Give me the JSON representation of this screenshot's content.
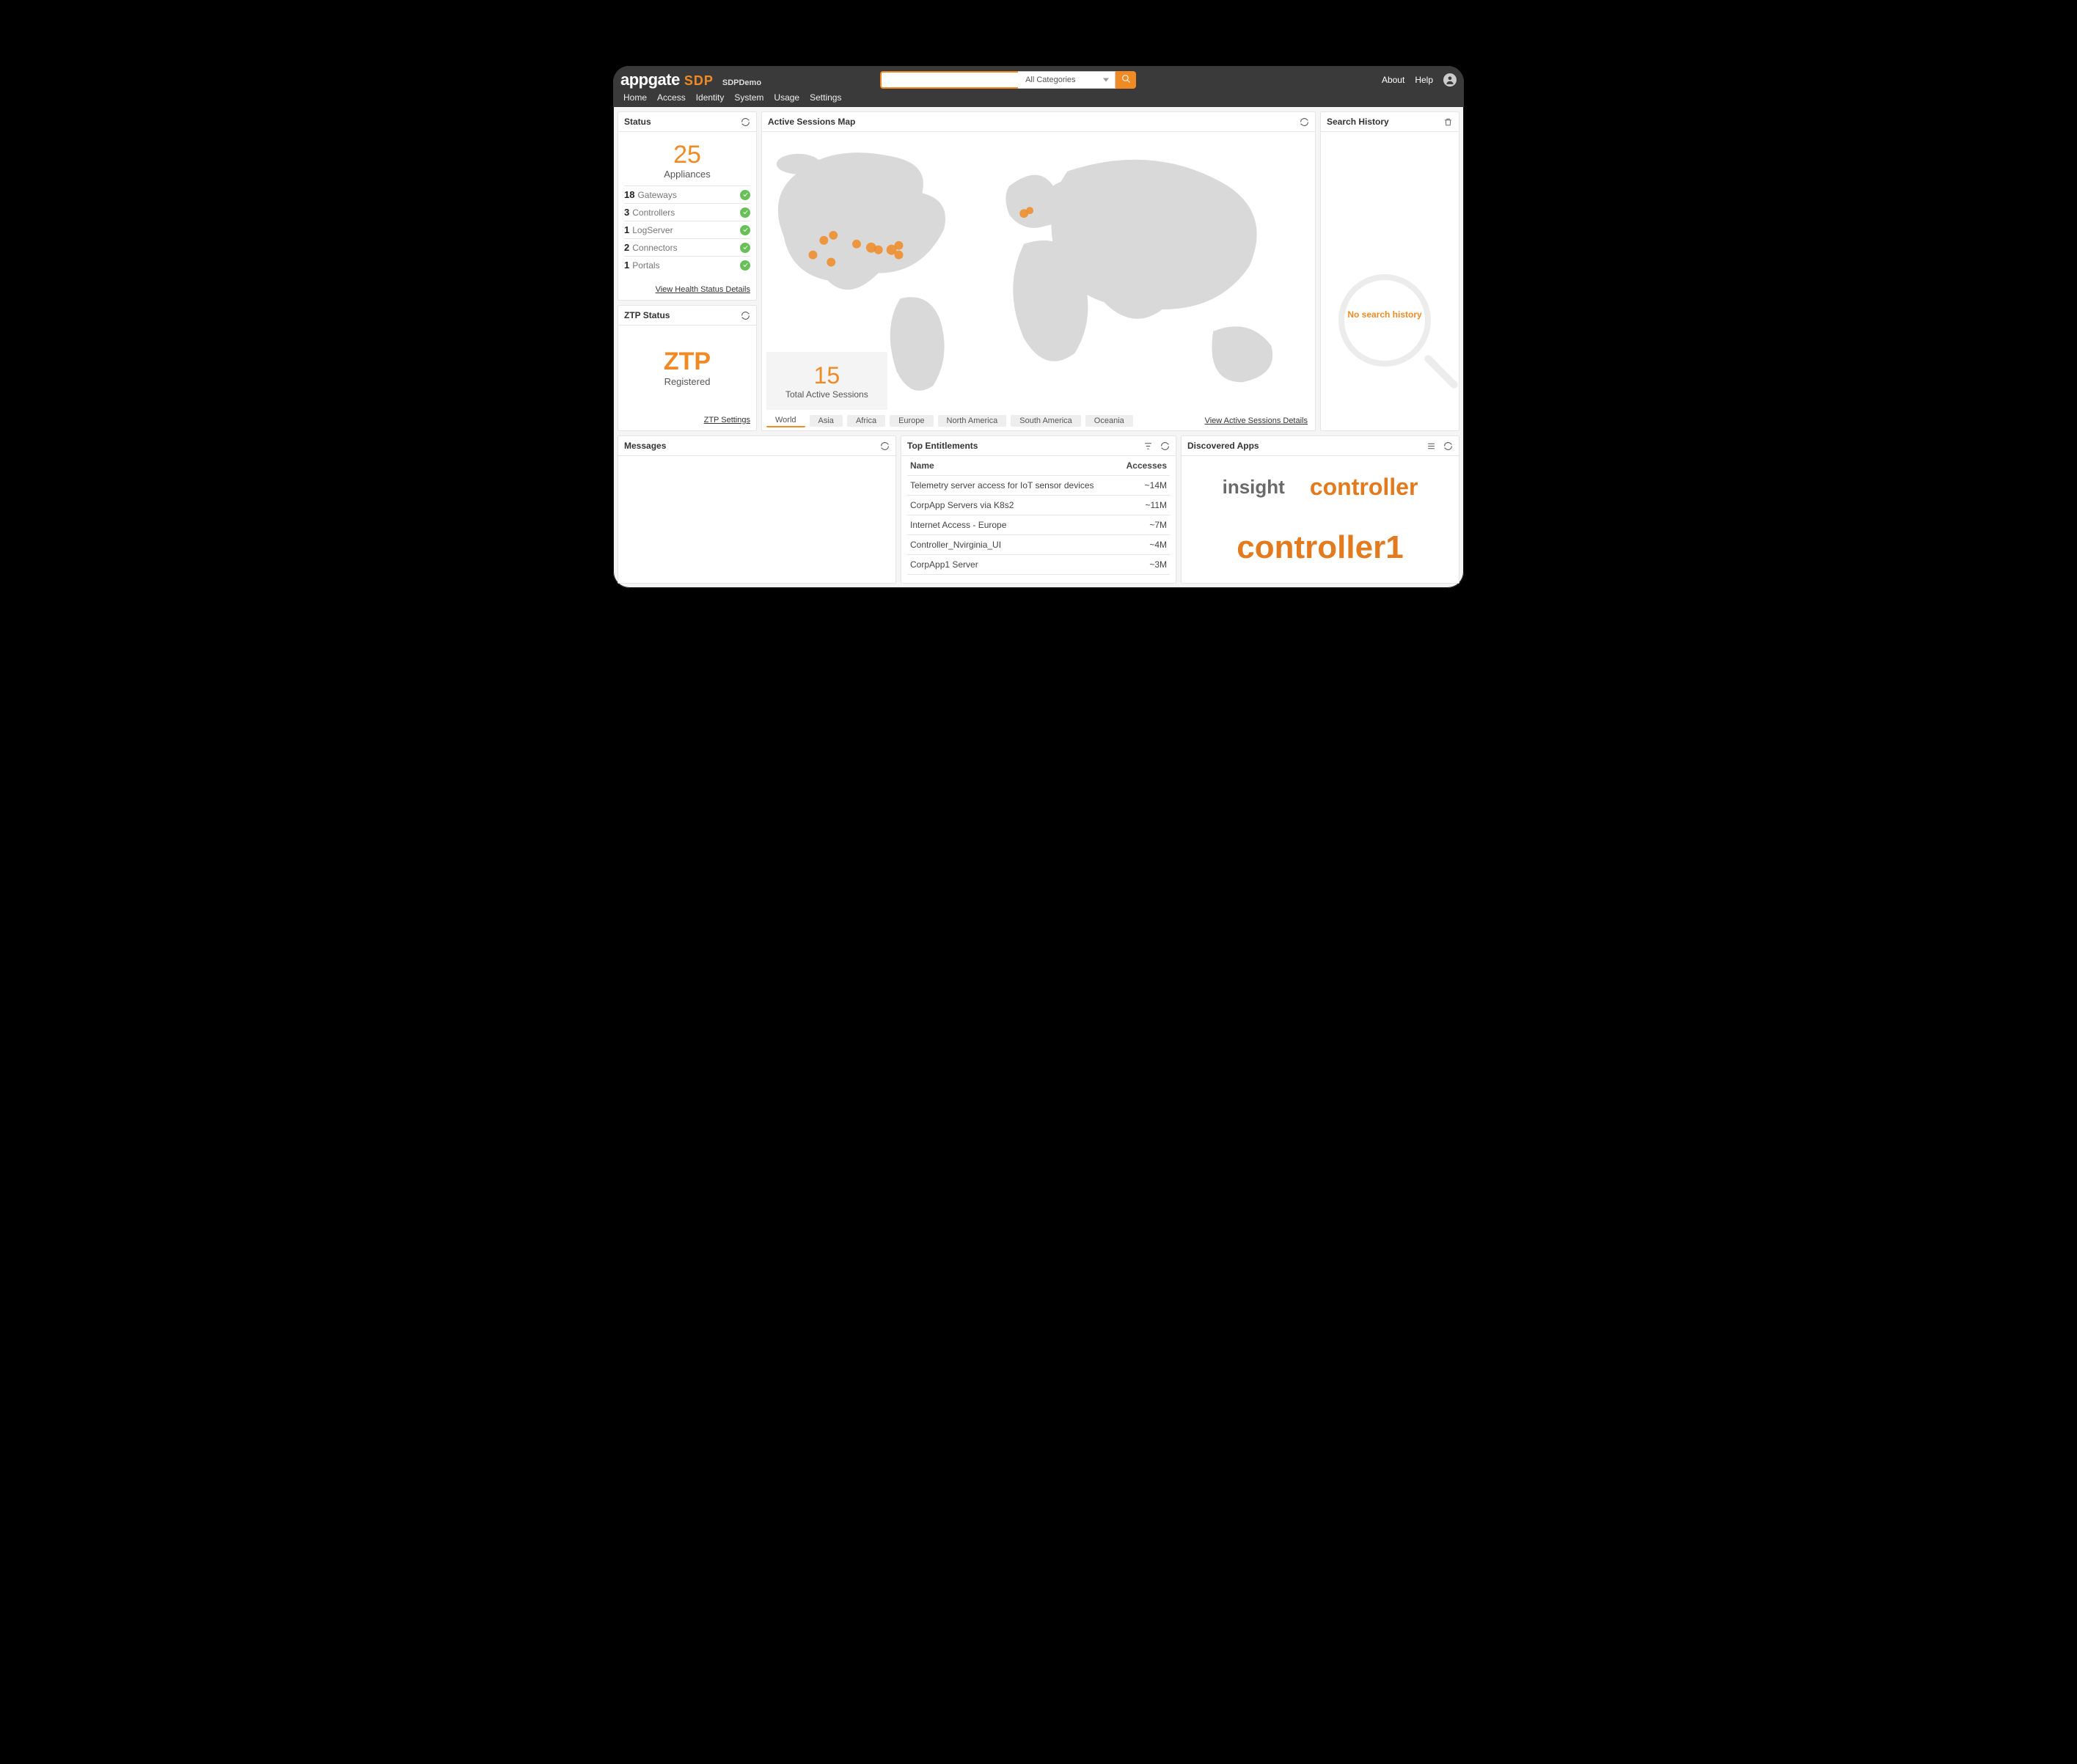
{
  "header": {
    "brand1": "appgate",
    "brand2": "SDP",
    "env": "SDPDemo",
    "search_value": "",
    "search_placeholder": "",
    "category_selected": "All Categories",
    "links": {
      "about": "About",
      "help": "Help"
    },
    "menu": [
      "Home",
      "Access",
      "Identity",
      "System",
      "Usage",
      "Settings"
    ]
  },
  "status_panel": {
    "title": "Status",
    "count": "25",
    "count_label": "Appliances",
    "rows": [
      {
        "count": "18",
        "label": "Gateways"
      },
      {
        "count": "3",
        "label": "Controllers"
      },
      {
        "count": "1",
        "label": "LogServer"
      },
      {
        "count": "2",
        "label": "Connectors"
      },
      {
        "count": "1",
        "label": "Portals"
      }
    ],
    "footer_link": "View Health Status Details"
  },
  "ztp_panel": {
    "title": "ZTP Status",
    "big": "ZTP",
    "sub": "Registered",
    "footer_link": "ZTP Settings"
  },
  "map_panel": {
    "title": "Active Sessions Map",
    "sessions_count": "15",
    "sessions_label": "Total Active Sessions",
    "footer_link": "View Active Sessions Details",
    "tabs": [
      "World",
      "Asia",
      "Africa",
      "Europe",
      "North America",
      "South America",
      "Oceania"
    ],
    "active_tab": "World"
  },
  "search_history": {
    "title": "Search History",
    "empty_text": "No search history"
  },
  "messages_panel": {
    "title": "Messages"
  },
  "entitlements_panel": {
    "title": "Top Entitlements",
    "col_name": "Name",
    "col_accesses": "Accesses",
    "rows": [
      {
        "name": "Telemetry server access for IoT sensor devices",
        "accesses": "~14M"
      },
      {
        "name": "CorpApp Servers via K8s2",
        "accesses": "~11M"
      },
      {
        "name": "Internet Access - Europe",
        "accesses": "~7M"
      },
      {
        "name": "Controller_Nvirginia_UI",
        "accesses": "~4M"
      },
      {
        "name": "CorpApp1 Server",
        "accesses": "~3M"
      }
    ]
  },
  "discovered_panel": {
    "title": "Discovered Apps",
    "words": [
      {
        "text": "insight",
        "size": 26,
        "color": "#6a6a6a",
        "weight": 600
      },
      {
        "text": "controller",
        "size": 32,
        "color": "#e37a1e",
        "weight": 700
      },
      {
        "text": "controller1",
        "size": 44,
        "color": "#e37a1e",
        "weight": 700
      }
    ]
  }
}
